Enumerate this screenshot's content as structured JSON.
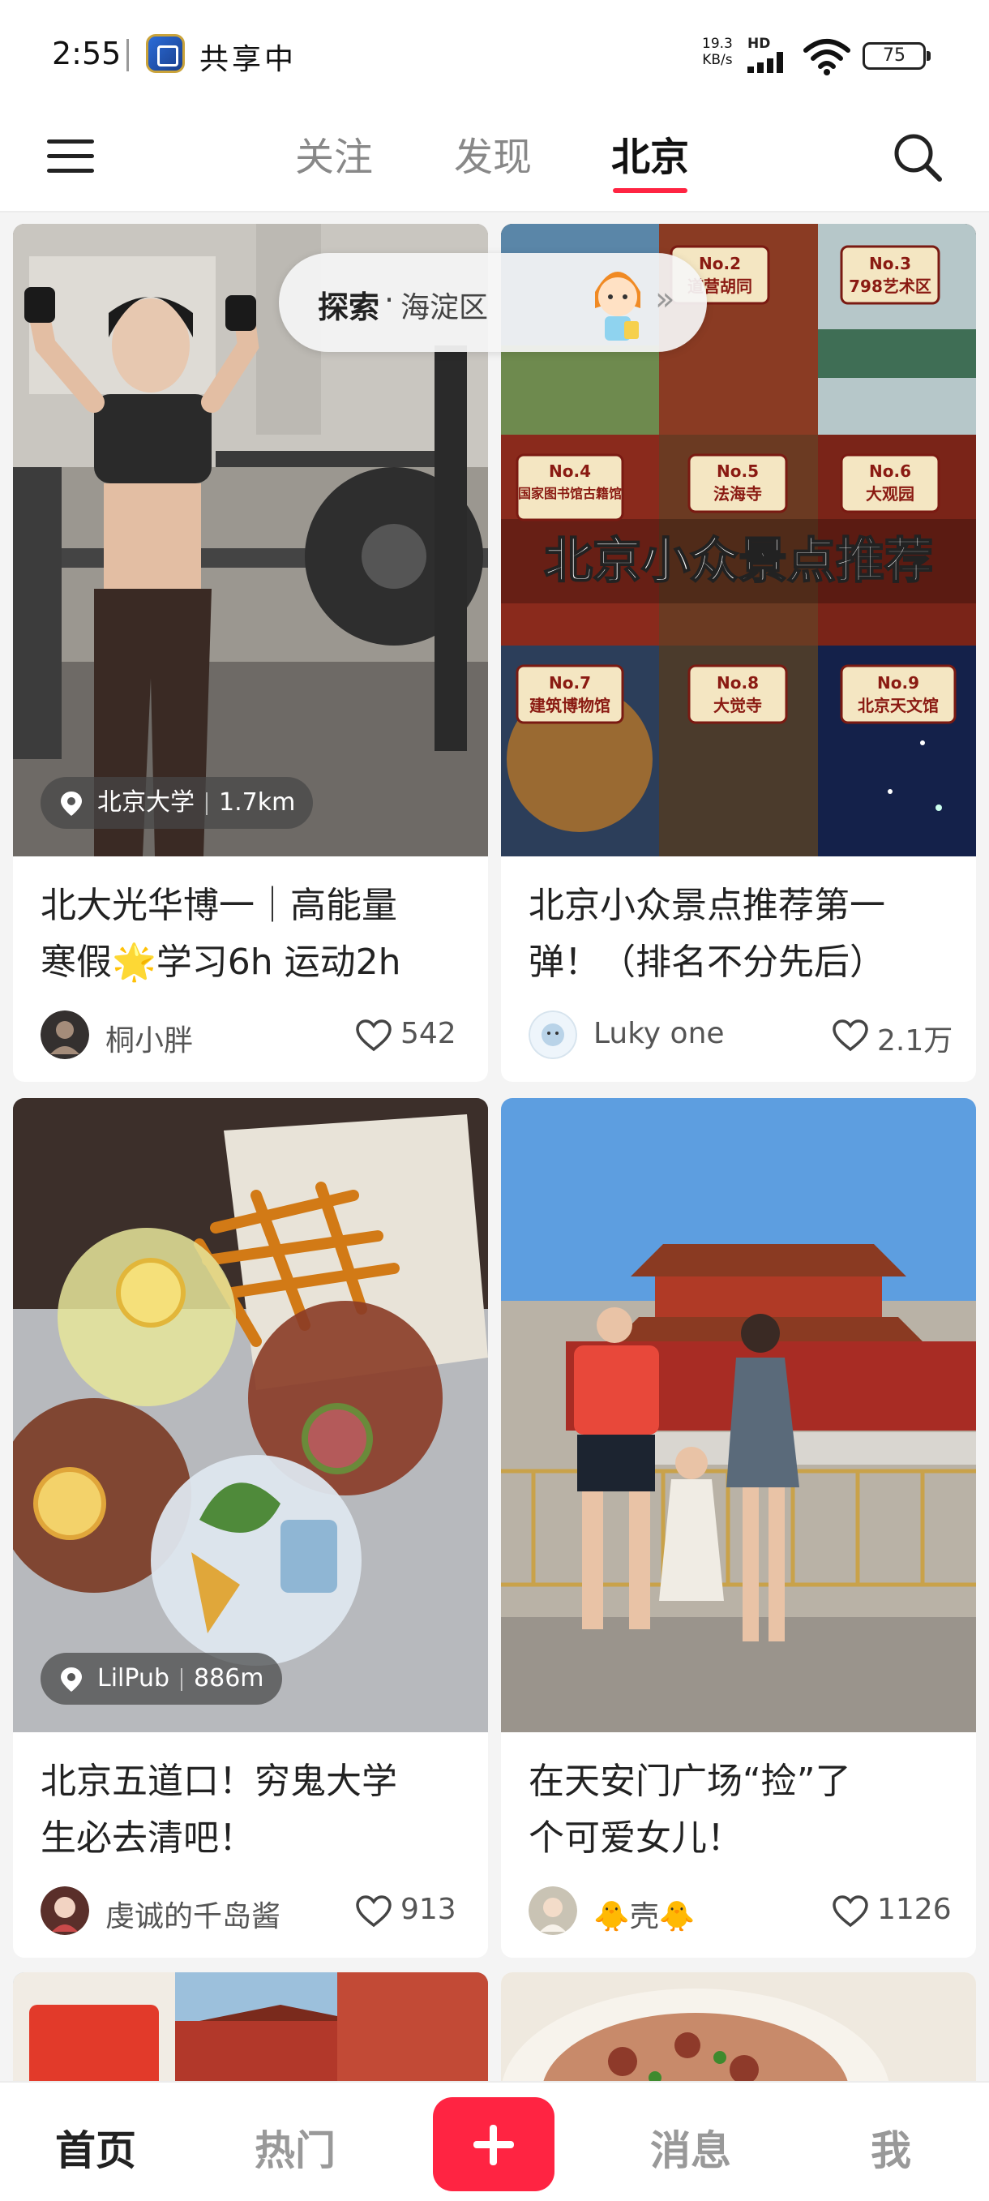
{
  "status_bar": {
    "time": "2:55",
    "sharing_label": "共享中",
    "net_speed_value": "19.3",
    "net_speed_unit": "KB/s",
    "network_badge": "HD",
    "battery_level": "75"
  },
  "top_nav": {
    "tabs": [
      {
        "label": "关注",
        "active": false
      },
      {
        "label": "发现",
        "active": false
      },
      {
        "label": "北京",
        "active": true
      }
    ]
  },
  "explore_pill": {
    "bold_label": "探索",
    "separator": "·",
    "area": "海淀区",
    "arrow": "»"
  },
  "feed": {
    "cards": [
      {
        "title_line1": "北大光华博一｜高能量",
        "title_line2": "寒假🌟学习6h 运动2h",
        "location": "北京大学",
        "distance": "1.7km",
        "author": "桐小胖",
        "likes": "542"
      },
      {
        "title_line1": "北京小众景点推荐第一",
        "title_line2": "弹！（排名不分先后）",
        "author": "Luky one",
        "likes": "2.1万",
        "image_text": {
          "banner": "北京小众景点推荐",
          "spots": [
            {
              "no": "No.2",
              "name": "道营胡同"
            },
            {
              "no": "No.3",
              "name": "798艺术区"
            },
            {
              "no": "No.4",
              "name": "国家图书馆古籍馆"
            },
            {
              "no": "No.5",
              "name": "法海寺"
            },
            {
              "no": "No.6",
              "name": "大观园"
            },
            {
              "no": "No.7",
              "name": "建筑博物馆"
            },
            {
              "no": "No.8",
              "name": "大觉寺"
            },
            {
              "no": "No.9",
              "name": "北京天文馆"
            }
          ]
        }
      },
      {
        "title_line1": "北京五道口！穷鬼大学",
        "title_line2": "生必去清吧！",
        "location": "LilPub",
        "distance": "886m",
        "author": "虔诚的千岛酱",
        "likes": "913"
      },
      {
        "title_line1": "在天安门广场“捡”了",
        "title_line2": "个可爱女儿！",
        "author": "🐥壳🐥",
        "likes": "1126"
      }
    ]
  },
  "bottom_nav": {
    "items": [
      {
        "label": "首页",
        "active": true
      },
      {
        "label": "热门",
        "active": false
      },
      {
        "label": "消息",
        "active": false
      },
      {
        "label": "我",
        "active": false
      }
    ]
  },
  "colors": {
    "accent": "#ff2442",
    "background": "#f4f4f4",
    "card": "#ffffff"
  }
}
